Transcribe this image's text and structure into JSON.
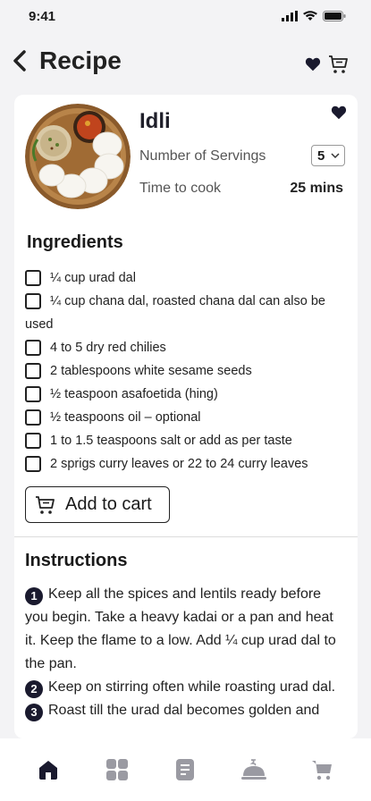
{
  "status": {
    "time": "9:41"
  },
  "header": {
    "title": "Recipe"
  },
  "recipe": {
    "name": "Idli",
    "servings_label": "Number of Servings",
    "servings_value": "5",
    "cook_label": "Time to cook",
    "cook_value": "25 mins"
  },
  "ingredients": {
    "title": "Ingredients",
    "items": [
      "¼ cup urad dal",
      "¼ cup chana dal, roasted chana dal can also be used",
      "4 to 5 dry red chilies",
      "2 tablespoons white sesame seeds",
      "½ teaspoon asafoetida (hing)",
      "½ teaspoons oil – optional",
      "1 to 1.5 teaspoons salt or add as per taste",
      "2 sprigs curry leaves or 22 to 24 curry leaves"
    ],
    "add_to_cart_label": "Add to cart"
  },
  "instructions": {
    "title": "Instructions",
    "steps": [
      {
        "num": "1",
        "text": "Keep all the spices and lentils ready before you begin. Take a heavy kadai or a pan and heat it. Keep the flame to a low. Add ¼ cup urad dal to the pan."
      },
      {
        "num": "2",
        "text": "Keep on stirring often while roasting urad dal."
      },
      {
        "num": "3",
        "text": "Roast till the urad dal becomes golden and"
      }
    ]
  },
  "nav": {
    "items": [
      "home-icon",
      "grid-icon",
      "document-icon",
      "cloche-icon",
      "cart-icon"
    ],
    "active": "home-icon"
  },
  "colors": {
    "accent": "#1a1a2e",
    "background": "#f3f3f5",
    "card": "#ffffff"
  }
}
